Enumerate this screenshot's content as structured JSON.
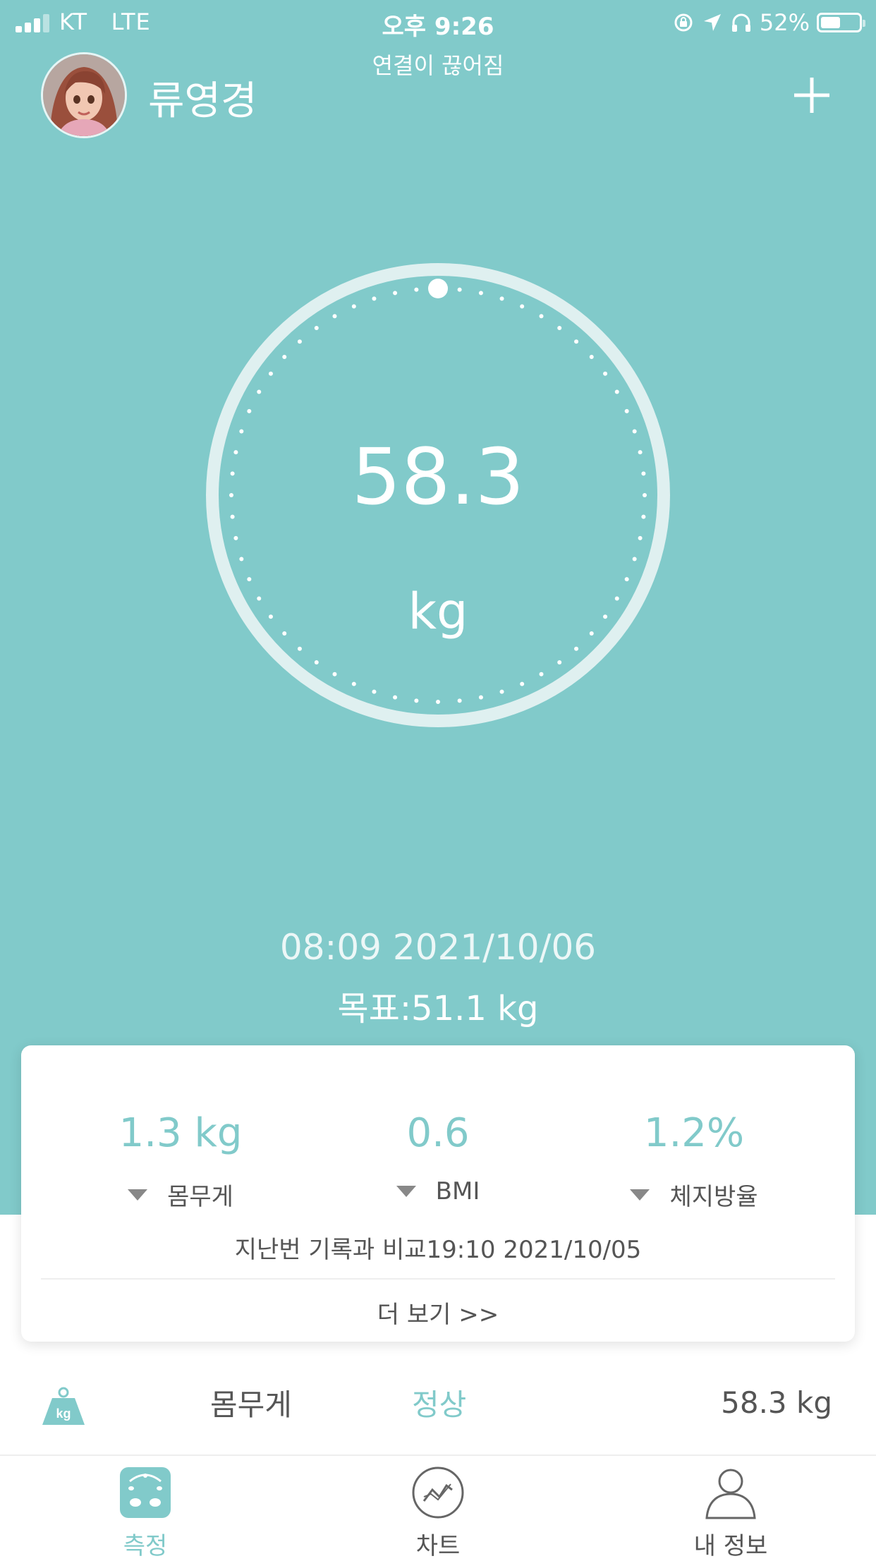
{
  "status_bar": {
    "carrier": "KT",
    "network": "LTE",
    "time": "오후 9:26",
    "battery": "52%",
    "battery_level": 0.52
  },
  "header": {
    "connection_status": "연결이 끊어짐",
    "user_name": "류영경",
    "add_icon": "plus-icon",
    "avatar_icon": "avatar"
  },
  "gauge": {
    "weight_value": "58.3",
    "weight_unit": "kg",
    "ring_color": "#DFF0F0"
  },
  "measurement": {
    "datetime": "08:09 2021/10/06",
    "goal": "목표:51.1 kg"
  },
  "comparison_card": {
    "stats": [
      {
        "value": "1.3 kg",
        "label": "몸무게",
        "trend_icon": "triangle-down-icon"
      },
      {
        "value": "0.6",
        "label": "BMI",
        "trend_icon": "triangle-down-icon"
      },
      {
        "value": "1.2%",
        "label": "체지방율",
        "trend_icon": "triangle-down-icon"
      }
    ],
    "compare_text": "지난번 기록과 비교19:10 2021/10/05",
    "more_label": "더 보기 >>"
  },
  "metric_row": {
    "icon": "kg-weight-icon",
    "icon_text": "kg",
    "name": "몸무게",
    "status": "정상",
    "value": "58.3 kg"
  },
  "tabs": [
    {
      "label": "측정",
      "icon": "scale-icon",
      "active": true
    },
    {
      "label": "차트",
      "icon": "chart-icon",
      "active": false
    },
    {
      "label": "내 정보",
      "icon": "person-icon",
      "active": false
    }
  ],
  "colors": {
    "accent": "#81CACA",
    "text": "#555555",
    "background": "#FFFFFF"
  }
}
